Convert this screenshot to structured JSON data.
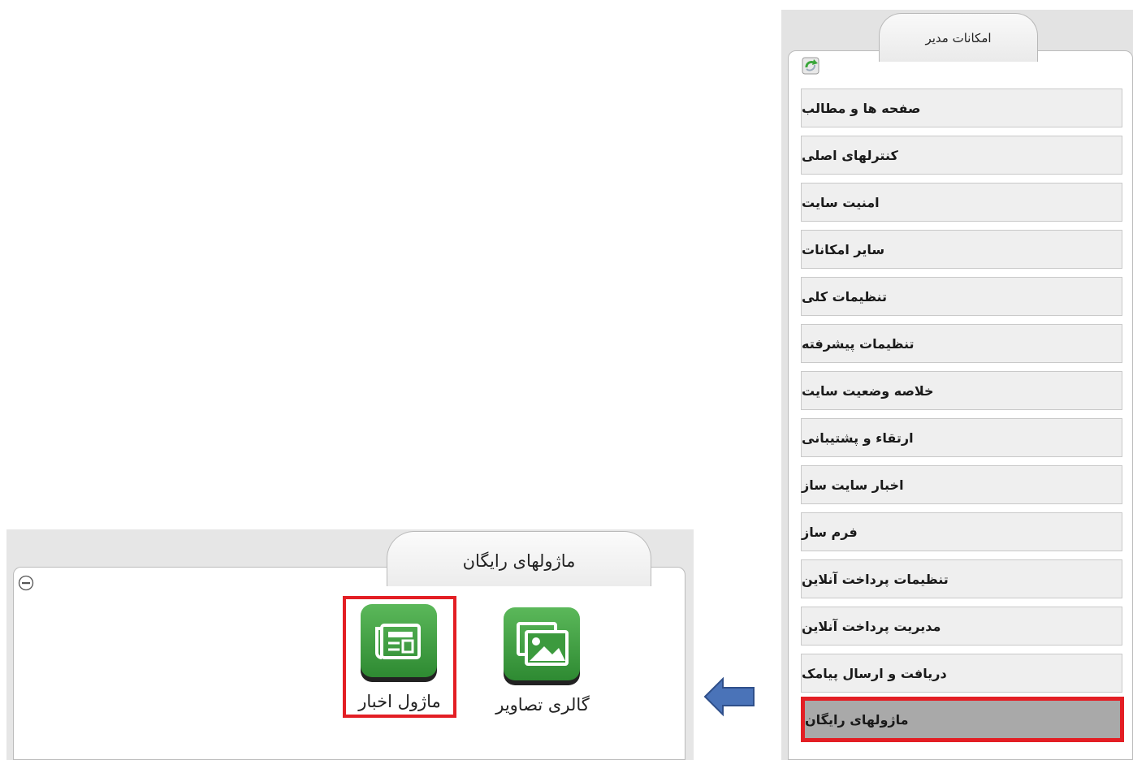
{
  "admin_panel": {
    "title": "امکانات مدیر",
    "items": [
      {
        "label": "صفحه ها و مطالب"
      },
      {
        "label": "کنترلهای اصلی"
      },
      {
        "label": "امنیت سایت"
      },
      {
        "label": "سایر امکانات"
      },
      {
        "label": "تنظیمات کلی"
      },
      {
        "label": "تنظیمات پیشرفته"
      },
      {
        "label": "خلاصه وضعیت سایت"
      },
      {
        "label": "ارتقاء و پشتیبانی"
      },
      {
        "label": "اخبار سایت ساز"
      },
      {
        "label": "فرم ساز"
      },
      {
        "label": "تنظیمات پرداخت آنلاین"
      },
      {
        "label": "مدیریت پرداخت آنلاین"
      },
      {
        "label": "دریافت و ارسال پیامک"
      },
      {
        "label": "ماژولهای رایگان",
        "active": true
      }
    ]
  },
  "modules_panel": {
    "title": "ماژولهای رایگان",
    "modules": [
      {
        "label": "گالری تصاویر",
        "icon": "image-gallery-icon"
      },
      {
        "label": "ماژول اخبار",
        "icon": "newspaper-icon",
        "highlighted": true
      }
    ]
  },
  "colors": {
    "highlight": "#e31e24",
    "module_green": "#3c9a3e",
    "arrow_blue": "#4a73b8"
  }
}
